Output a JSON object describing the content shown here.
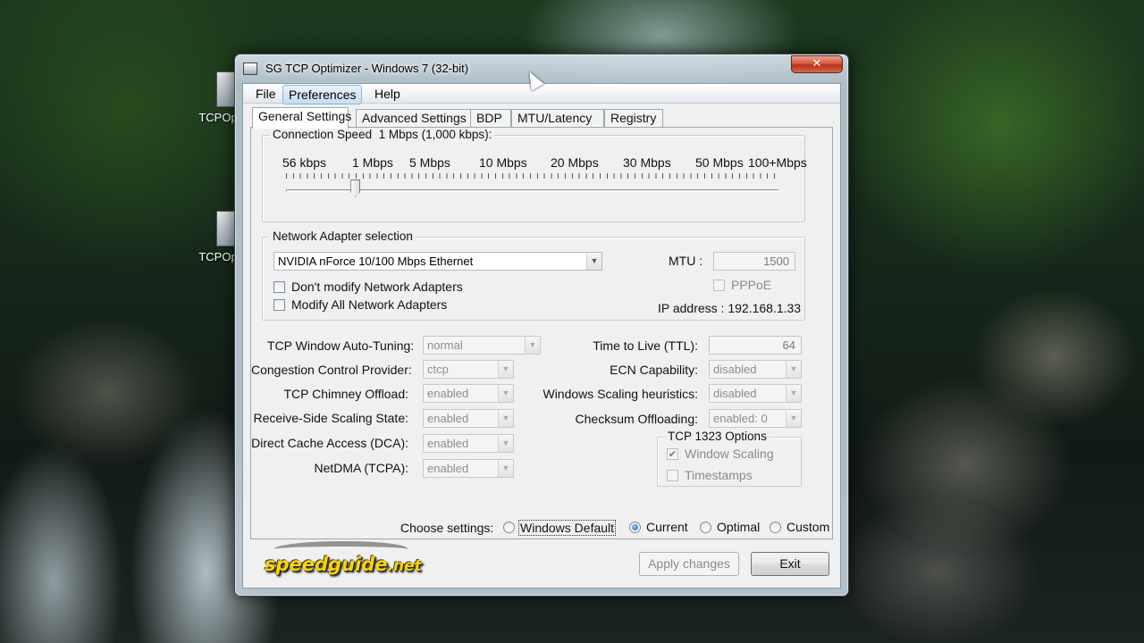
{
  "desktop": {
    "icons": [
      {
        "label": "TCPOp"
      },
      {
        "label": "TCPOp"
      }
    ]
  },
  "window": {
    "title": "SG TCP Optimizer - Windows 7 (32-bit)",
    "close_label": "✕",
    "menu": [
      "File",
      "Preferences",
      "Help"
    ],
    "tabs": [
      "General Settings",
      "Advanced Settings",
      "BDP",
      "MTU/Latency",
      "Registry"
    ],
    "active_tab": "General Settings"
  },
  "connection": {
    "group_title": "Connection Speed",
    "current_value": "1 Mbps (1,000 kbps):",
    "speed_marks": [
      "56 kbps",
      "1 Mbps",
      "5 Mbps",
      "10 Mbps",
      "20 Mbps",
      "30 Mbps",
      "50 Mbps",
      "100+Mbps"
    ],
    "slider_fraction": 0.14
  },
  "adapter": {
    "group_title": "Network Adapter selection",
    "selected": "NVIDIA nForce 10/100 Mbps Ethernet",
    "mtu_label": "MTU :",
    "mtu_value": "1500",
    "pppoe_label": "PPPoE",
    "dont_modify_label": "Don't modify Network Adapters",
    "modify_all_label": "Modify All Network Adapters",
    "ip_address": "IP address : 192.168.1.33"
  },
  "settings_left": [
    {
      "label": "TCP Window Auto-Tuning:",
      "value": "normal"
    },
    {
      "label": "Congestion Control Provider:",
      "value": "ctcp"
    },
    {
      "label": "TCP Chimney Offload:",
      "value": "enabled"
    },
    {
      "label": "Receive-Side Scaling State:",
      "value": "enabled"
    },
    {
      "label": "Direct Cache Access (DCA):",
      "value": "enabled"
    },
    {
      "label": "NetDMA (TCPA):",
      "value": "enabled"
    }
  ],
  "settings_right": {
    "ttl_label": "Time to Live (TTL):",
    "ttl_value": "64",
    "ecn_label": "ECN Capability:",
    "ecn_value": "disabled",
    "wsh_label": "Windows Scaling heuristics:",
    "wsh_value": "disabled",
    "checksum_label": "Checksum Offloading:",
    "checksum_value": "enabled: 0",
    "tcp1323_title": "TCP 1323 Options",
    "window_scaling_label": "Window Scaling",
    "window_scaling_checked": true,
    "timestamps_label": "Timestamps",
    "timestamps_checked": false
  },
  "choose": {
    "label": "Choose settings:",
    "options": [
      "Windows Default",
      "Current",
      "Optimal",
      "Custom"
    ],
    "selected": "Current"
  },
  "footer": {
    "logo_main": "speedguide",
    "logo_suffix": ".net",
    "apply_label": "Apply changes",
    "exit_label": "Exit"
  }
}
